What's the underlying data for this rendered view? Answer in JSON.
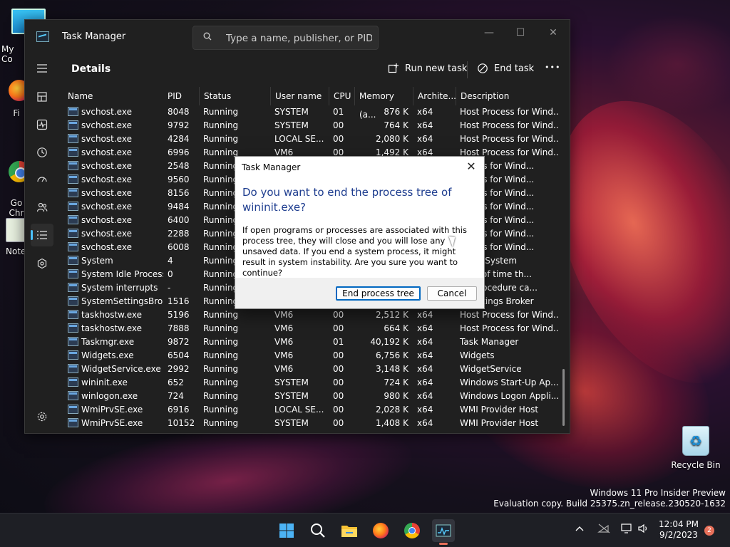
{
  "desktop": {
    "icons": [
      {
        "label": "My Co"
      },
      {
        "label": "Fi"
      },
      {
        "label": "Go\nChr"
      },
      {
        "label": "Note"
      },
      {
        "label": "Recycle Bin"
      }
    ],
    "watermark_line1": "Windows 11 Pro Insider Preview",
    "watermark_line2": "Evaluation copy. Build 25375.zn_release.230520-1632"
  },
  "window": {
    "title": "Task Manager",
    "search_placeholder": "Type a name, publisher, or PID...",
    "controls": {
      "minimize": "—",
      "maximize": "☐",
      "close": "✕"
    },
    "page_title": "Details",
    "commands": {
      "run_new_task": "Run new task",
      "end_task": "End task",
      "more": "•••"
    },
    "nav_icons": [
      "hamburger-icon",
      "processes-icon",
      "performance-icon",
      "app-history-icon",
      "startup-apps-icon",
      "users-icon",
      "details-icon",
      "services-icon",
      "settings-icon"
    ],
    "columns": [
      "Name",
      "PID",
      "Status",
      "User name",
      "CPU",
      "Memory (a...",
      "Archite...",
      "Description"
    ],
    "rows": [
      {
        "name": "svchost.exe",
        "pid": "8048",
        "status": "Running",
        "user": "SYSTEM",
        "cpu": "01",
        "mem": "876 K",
        "arch": "x64",
        "desc": "Host Process for Wind..."
      },
      {
        "name": "svchost.exe",
        "pid": "9792",
        "status": "Running",
        "user": "SYSTEM",
        "cpu": "00",
        "mem": "764 K",
        "arch": "x64",
        "desc": "Host Process for Wind..."
      },
      {
        "name": "svchost.exe",
        "pid": "4284",
        "status": "Running",
        "user": "LOCAL SE...",
        "cpu": "00",
        "mem": "2,080 K",
        "arch": "x64",
        "desc": "Host Process for Wind..."
      },
      {
        "name": "svchost.exe",
        "pid": "6996",
        "status": "Running",
        "user": "VM6",
        "cpu": "00",
        "mem": "1,492 K",
        "arch": "x64",
        "desc": "Host Process for Wind..."
      },
      {
        "name": "svchost.exe",
        "pid": "2548",
        "status": "Running",
        "user": "",
        "cpu": "",
        "mem": "",
        "arch": "",
        "desc": "rocess for Wind..."
      },
      {
        "name": "svchost.exe",
        "pid": "9560",
        "status": "Running",
        "user": "",
        "cpu": "",
        "mem": "",
        "arch": "",
        "desc": "rocess for Wind..."
      },
      {
        "name": "svchost.exe",
        "pid": "8156",
        "status": "Running",
        "user": "",
        "cpu": "",
        "mem": "",
        "arch": "",
        "desc": "rocess for Wind..."
      },
      {
        "name": "svchost.exe",
        "pid": "9484",
        "status": "Running",
        "user": "",
        "cpu": "",
        "mem": "",
        "arch": "",
        "desc": "rocess for Wind..."
      },
      {
        "name": "svchost.exe",
        "pid": "6400",
        "status": "Running",
        "user": "",
        "cpu": "",
        "mem": "",
        "arch": "",
        "desc": "rocess for Wind..."
      },
      {
        "name": "svchost.exe",
        "pid": "2288",
        "status": "Running",
        "user": "",
        "cpu": "",
        "mem": "",
        "arch": "",
        "desc": "rocess for Wind..."
      },
      {
        "name": "svchost.exe",
        "pid": "6008",
        "status": "Running",
        "user": "",
        "cpu": "",
        "mem": "",
        "arch": "",
        "desc": "rocess for Wind..."
      },
      {
        "name": "System",
        "pid": "4",
        "status": "Running",
        "user": "",
        "cpu": "",
        "mem": "",
        "arch": "",
        "desc": "nel & System"
      },
      {
        "name": "System Idle Process",
        "pid": "0",
        "status": "Running",
        "user": "",
        "cpu": "",
        "mem": "",
        "arch": "",
        "desc": "tage of time th..."
      },
      {
        "name": "System interrupts",
        "pid": "-",
        "status": "Running",
        "user": "",
        "cpu": "",
        "mem": "",
        "arch": "",
        "desc": "ed procedure ca..."
      },
      {
        "name": "SystemSettingsBroke...",
        "pid": "1516",
        "status": "Running",
        "user": "",
        "cpu": "",
        "mem": "",
        "arch": "",
        "desc": "n Settings Broker"
      },
      {
        "name": "taskhostw.exe",
        "pid": "5196",
        "status": "Running",
        "user": "VM6",
        "cpu": "00",
        "mem": "2,512 K",
        "arch": "x64",
        "desc": "Host Process for Wind..."
      },
      {
        "name": "taskhostw.exe",
        "pid": "7888",
        "status": "Running",
        "user": "VM6",
        "cpu": "00",
        "mem": "664 K",
        "arch": "x64",
        "desc": "Host Process for Wind..."
      },
      {
        "name": "Taskmgr.exe",
        "pid": "9872",
        "status": "Running",
        "user": "VM6",
        "cpu": "01",
        "mem": "40,192 K",
        "arch": "x64",
        "desc": "Task Manager"
      },
      {
        "name": "Widgets.exe",
        "pid": "6504",
        "status": "Running",
        "user": "VM6",
        "cpu": "00",
        "mem": "6,756 K",
        "arch": "x64",
        "desc": "Widgets"
      },
      {
        "name": "WidgetService.exe",
        "pid": "2992",
        "status": "Running",
        "user": "VM6",
        "cpu": "00",
        "mem": "3,148 K",
        "arch": "x64",
        "desc": "WidgetService"
      },
      {
        "name": "wininit.exe",
        "pid": "652",
        "status": "Running",
        "user": "SYSTEM",
        "cpu": "00",
        "mem": "724 K",
        "arch": "x64",
        "desc": "Windows Start-Up Ap..."
      },
      {
        "name": "winlogon.exe",
        "pid": "724",
        "status": "Running",
        "user": "SYSTEM",
        "cpu": "00",
        "mem": "980 K",
        "arch": "x64",
        "desc": "Windows Logon Appli..."
      },
      {
        "name": "WmiPrvSE.exe",
        "pid": "6916",
        "status": "Running",
        "user": "LOCAL SE...",
        "cpu": "00",
        "mem": "2,028 K",
        "arch": "x64",
        "desc": "WMI Provider Host"
      },
      {
        "name": "WmiPrvSE.exe",
        "pid": "10152",
        "status": "Running",
        "user": "SYSTEM",
        "cpu": "00",
        "mem": "1,408 K",
        "arch": "x64",
        "desc": "WMI Provider Host"
      }
    ]
  },
  "dialog": {
    "title": "Task Manager",
    "close": "✕",
    "heading": "Do you want to end the process tree of wininit.exe?",
    "body": "If open programs or processes are associated with this process tree, they will close and you will lose any unsaved data. If you end a system process, it might result in system instability. Are you sure you want to continue?",
    "primary_button": "End process tree",
    "cancel_button": "Cancel"
  },
  "taskbar": {
    "apps": [
      "start-icon",
      "search-icon",
      "file-explorer-icon",
      "firefox-icon",
      "chrome-icon",
      "task-manager-icon"
    ],
    "clock_time": "12:04 PM",
    "clock_date": "9/2/2023",
    "notifications": "2",
    "accent": "#e8705a"
  }
}
